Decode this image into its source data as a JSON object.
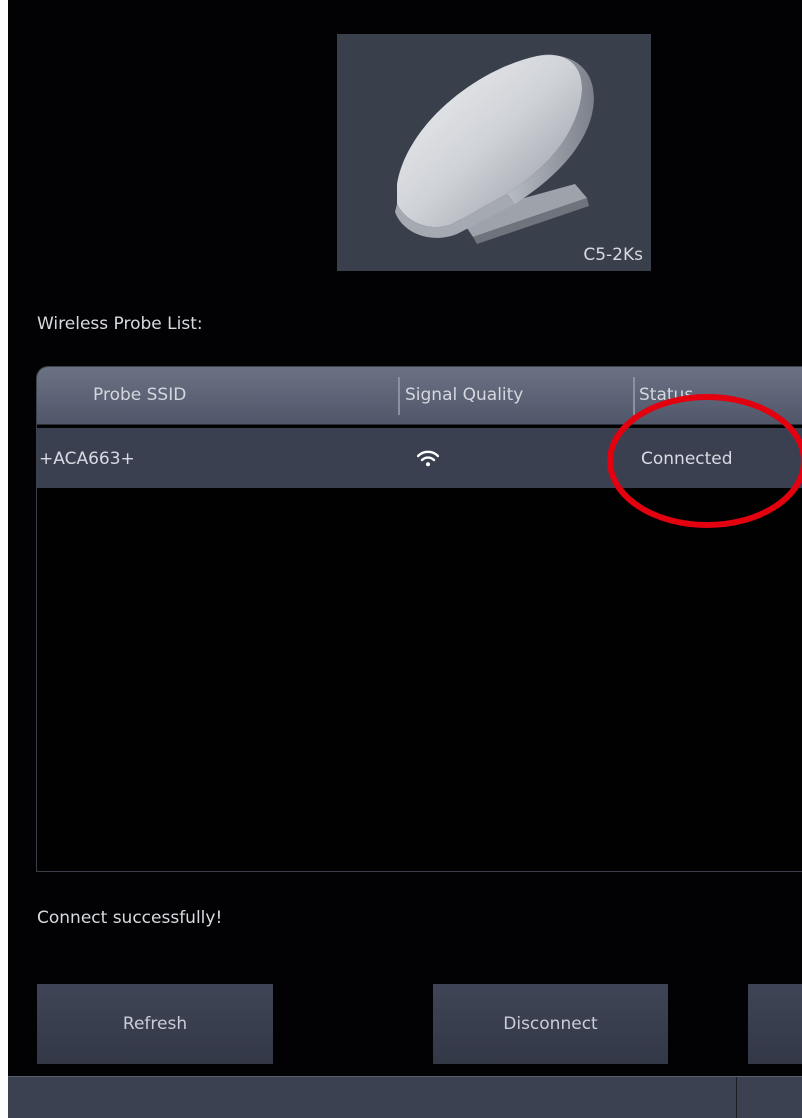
{
  "probe": {
    "model": "C5-2Ks"
  },
  "list": {
    "label": "Wireless Probe List:",
    "columns": [
      "Probe SSID",
      "Signal Quality",
      "Status"
    ],
    "rows": [
      {
        "ssid": "+ACA663+",
        "signal_icon": "wifi-icon",
        "status": "Connected"
      }
    ]
  },
  "message": "Connect successfully!",
  "buttons": {
    "refresh": "Refresh",
    "disconnect": "Disconnect"
  },
  "colors": {
    "background": "#020203",
    "header": "#5e6678",
    "selected_row": "#3b4050",
    "button": "#3a4050",
    "annotation": "#e3000f"
  }
}
